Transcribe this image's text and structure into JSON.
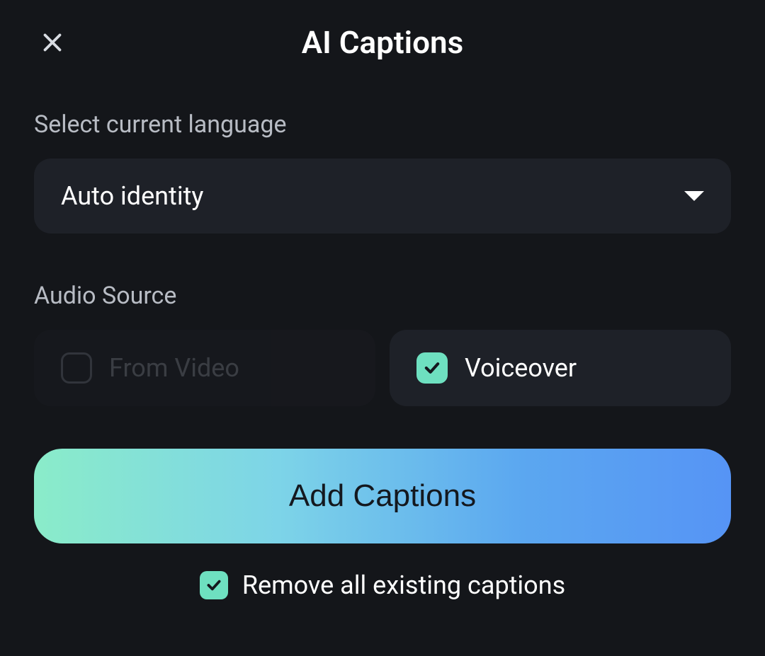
{
  "header": {
    "title": "AI Captions"
  },
  "language": {
    "label": "Select current language",
    "selected": "Auto identity"
  },
  "audioSource": {
    "label": "Audio Source",
    "options": [
      {
        "label": "From Video",
        "checked": false,
        "disabled": true
      },
      {
        "label": "Voiceover",
        "checked": true,
        "disabled": false
      }
    ]
  },
  "actions": {
    "addCaptions": "Add Captions",
    "removeExisting": {
      "label": "Remove all existing captions",
      "checked": true
    }
  },
  "colors": {
    "background": "#14161a",
    "panel": "#1e2128",
    "accent": "#6ee0c0",
    "gradientStart": "#8aecc9",
    "gradientEnd": "#5694f5"
  }
}
